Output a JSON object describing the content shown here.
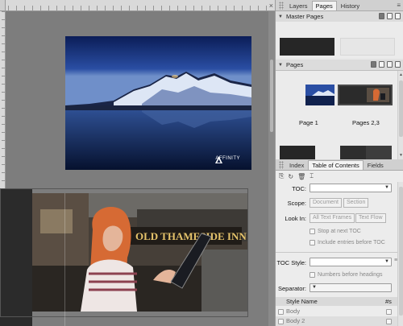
{
  "canvas": {
    "ruler_close": "×",
    "logo_text": "AFFINITY"
  },
  "top_panel": {
    "tabs": [
      "Layers",
      "Pages",
      "History"
    ],
    "active_tab": "Pages"
  },
  "master_pages": {
    "title": "Master Pages"
  },
  "pages": {
    "title": "Pages",
    "thumbnails": [
      {
        "label": "Page 1"
      },
      {
        "label": "Pages 2,3"
      }
    ]
  },
  "toc_panel": {
    "tabs": [
      "Index",
      "Table of Contents",
      "Fields"
    ],
    "active_tab": "Table of Contents",
    "toc_label": "TOC:",
    "toc_value": "",
    "scope_label": "Scope:",
    "scope_options": [
      "Document",
      "Section"
    ],
    "look_in_label": "Look In:",
    "look_in_options": [
      "All Text Frames",
      "Text Flow"
    ],
    "stop_at_next_toc": "Stop at next TOC",
    "include_entries_before": "Include entries before TOC",
    "toc_style_label": "TOC Style:",
    "toc_style_value": "",
    "numbers_before_headings": "Numbers before headings",
    "separator_label": "Separator:",
    "separator_value": "",
    "style_name_header": "Style Name",
    "number_header": "#s",
    "styles": [
      "Body",
      "Body 2"
    ]
  }
}
